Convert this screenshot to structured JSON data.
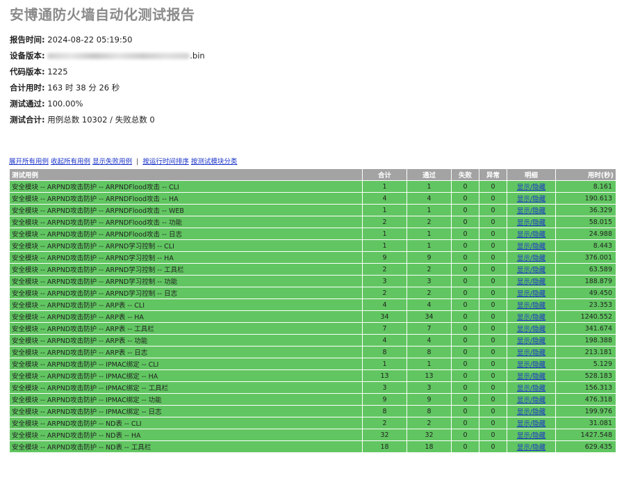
{
  "title": "安博通防火墙自动化测试报告",
  "info": [
    {
      "label": "报告时间:",
      "value": "2024-08-22 05:19:50"
    },
    {
      "label": "设备版本:",
      "value": ".bin"
    },
    {
      "label": "代码版本:",
      "value": "1225"
    },
    {
      "label": "合计用时:",
      "value": "163 时 38 分 26 秒"
    },
    {
      "label": "测试通过:",
      "value": "100.00%"
    },
    {
      "label": "测试合计:",
      "value": "用例总数 10302 / 失败总数 0"
    }
  ],
  "links": [
    "展开所有用例",
    "收起所有用例",
    "显示失败用例",
    "按运行时间排序",
    "按测试模块分类"
  ],
  "links_separator": "|",
  "columns": [
    "测试用例",
    "合计",
    "通过",
    "失败",
    "异常",
    "明细",
    "用时(秒)"
  ],
  "toggle_label": "显示/隐藏",
  "rows": [
    {
      "name": "安全模块 -- ARPND攻击防护 -- ARPNDFlood攻击 -- CLI",
      "total": "1",
      "pass": "1",
      "fail": "0",
      "error": "0",
      "time": "8.161"
    },
    {
      "name": "安全模块 -- ARPND攻击防护 -- ARPNDFlood攻击 -- HA",
      "total": "4",
      "pass": "4",
      "fail": "0",
      "error": "0",
      "time": "190.613"
    },
    {
      "name": "安全模块 -- ARPND攻击防护 -- ARPNDFlood攻击 -- WEB",
      "total": "1",
      "pass": "1",
      "fail": "0",
      "error": "0",
      "time": "36.329"
    },
    {
      "name": "安全模块 -- ARPND攻击防护 -- ARPNDFlood攻击 -- 功能",
      "total": "2",
      "pass": "2",
      "fail": "0",
      "error": "0",
      "time": "58.015"
    },
    {
      "name": "安全模块 -- ARPND攻击防护 -- ARPNDFlood攻击 -- 日志",
      "total": "1",
      "pass": "1",
      "fail": "0",
      "error": "0",
      "time": "24.988"
    },
    {
      "name": "安全模块 -- ARPND攻击防护 -- ARPND学习控制 -- CLI",
      "total": "1",
      "pass": "1",
      "fail": "0",
      "error": "0",
      "time": "8.443"
    },
    {
      "name": "安全模块 -- ARPND攻击防护 -- ARPND学习控制 -- HA",
      "total": "9",
      "pass": "9",
      "fail": "0",
      "error": "0",
      "time": "376.001"
    },
    {
      "name": "安全模块 -- ARPND攻击防护 -- ARPND学习控制 -- 工具栏",
      "total": "2",
      "pass": "2",
      "fail": "0",
      "error": "0",
      "time": "63.589"
    },
    {
      "name": "安全模块 -- ARPND攻击防护 -- ARPND学习控制 -- 功能",
      "total": "3",
      "pass": "3",
      "fail": "0",
      "error": "0",
      "time": "188.879"
    },
    {
      "name": "安全模块 -- ARPND攻击防护 -- ARPND学习控制 -- 日志",
      "total": "2",
      "pass": "2",
      "fail": "0",
      "error": "0",
      "time": "49.450"
    },
    {
      "name": "安全模块 -- ARPND攻击防护 -- ARP表 -- CLI",
      "total": "4",
      "pass": "4",
      "fail": "0",
      "error": "0",
      "time": "23.353"
    },
    {
      "name": "安全模块 -- ARPND攻击防护 -- ARP表 -- HA",
      "total": "34",
      "pass": "34",
      "fail": "0",
      "error": "0",
      "time": "1240.552"
    },
    {
      "name": "安全模块 -- ARPND攻击防护 -- ARP表 -- 工具栏",
      "total": "7",
      "pass": "7",
      "fail": "0",
      "error": "0",
      "time": "341.674"
    },
    {
      "name": "安全模块 -- ARPND攻击防护 -- ARP表 -- 功能",
      "total": "4",
      "pass": "4",
      "fail": "0",
      "error": "0",
      "time": "198.388"
    },
    {
      "name": "安全模块 -- ARPND攻击防护 -- ARP表 -- 日志",
      "total": "8",
      "pass": "8",
      "fail": "0",
      "error": "0",
      "time": "213.181"
    },
    {
      "name": "安全模块 -- ARPND攻击防护 -- IPMAC绑定 -- CLI",
      "total": "1",
      "pass": "1",
      "fail": "0",
      "error": "0",
      "time": "5.129"
    },
    {
      "name": "安全模块 -- ARPND攻击防护 -- IPMAC绑定 -- HA",
      "total": "13",
      "pass": "13",
      "fail": "0",
      "error": "0",
      "time": "528.183"
    },
    {
      "name": "安全模块 -- ARPND攻击防护 -- IPMAC绑定 -- 工具栏",
      "total": "3",
      "pass": "3",
      "fail": "0",
      "error": "0",
      "time": "156.313"
    },
    {
      "name": "安全模块 -- ARPND攻击防护 -- IPMAC绑定 -- 功能",
      "total": "9",
      "pass": "9",
      "fail": "0",
      "error": "0",
      "time": "476.318"
    },
    {
      "name": "安全模块 -- ARPND攻击防护 -- IPMAC绑定 -- 日志",
      "total": "8",
      "pass": "8",
      "fail": "0",
      "error": "0",
      "time": "199.976"
    },
    {
      "name": "安全模块 -- ARPND攻击防护 -- ND表 -- CLI",
      "total": "2",
      "pass": "2",
      "fail": "0",
      "error": "0",
      "time": "31.081"
    },
    {
      "name": "安全模块 -- ARPND攻击防护 -- ND表 -- HA",
      "total": "32",
      "pass": "32",
      "fail": "0",
      "error": "0",
      "time": "1427.548"
    },
    {
      "name": "安全模块 -- ARPND攻击防护 -- ND表 -- 工具栏",
      "total": "18",
      "pass": "18",
      "fail": "0",
      "error": "0",
      "time": "629.435"
    }
  ]
}
